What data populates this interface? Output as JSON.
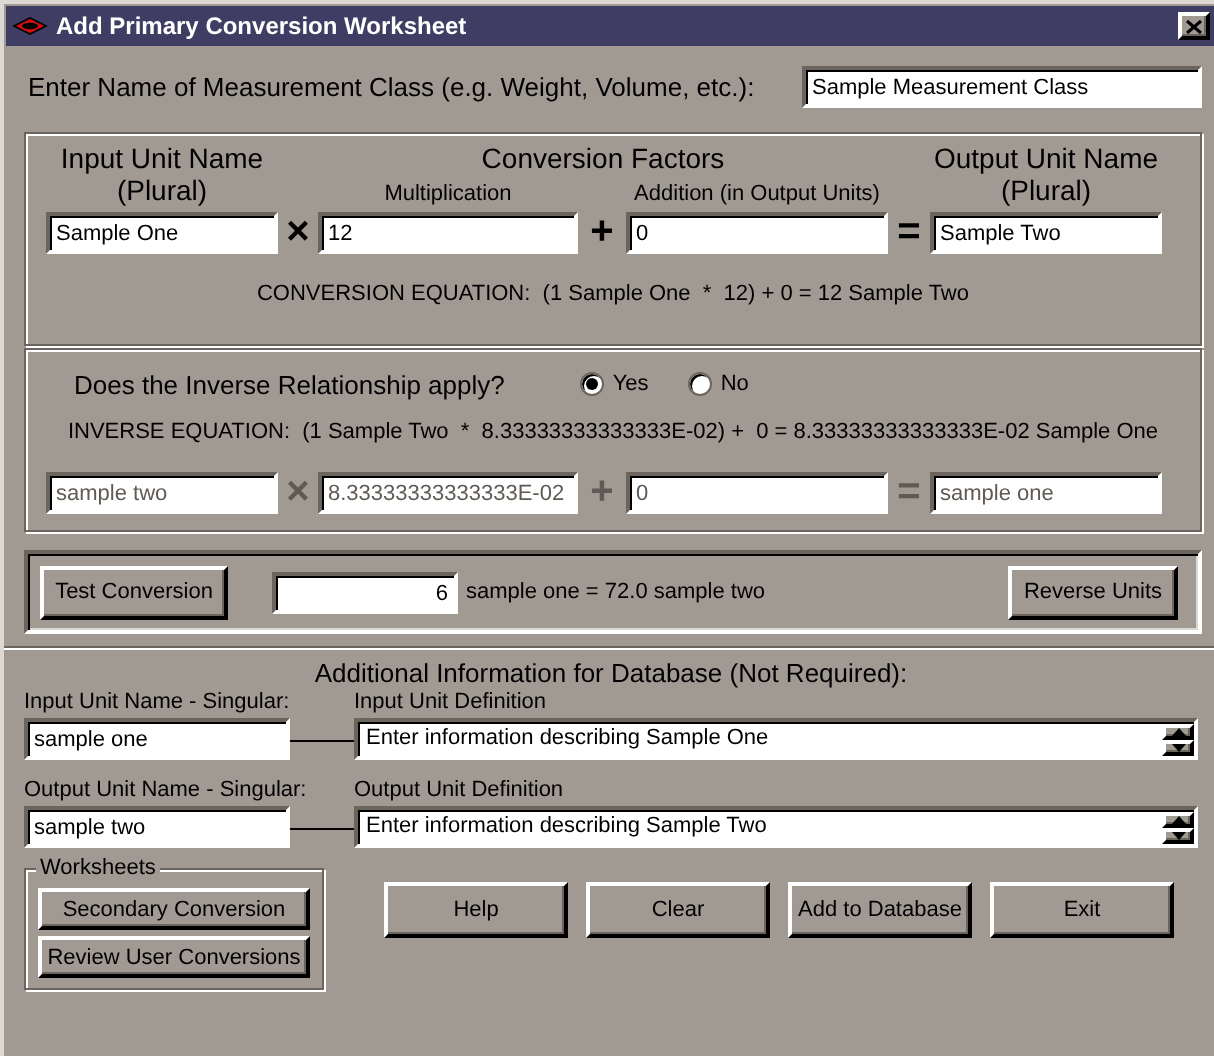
{
  "window": {
    "title": "Add Primary Conversion Worksheet"
  },
  "measurement_class": {
    "label": "Enter Name of Measurement Class (e.g. Weight, Volume, etc.):",
    "value": "Sample Measurement Class"
  },
  "conversion": {
    "input_heading": [
      "Input Unit Name",
      "(Plural)"
    ],
    "factors_heading": "Conversion Factors",
    "multiplication_label": "Multiplication",
    "addition_label": "Addition (in Output Units)",
    "output_heading": [
      "Output Unit Name",
      "(Plural)"
    ],
    "row": [
      {
        "kind": "field",
        "value": "Sample One",
        "disabled": false
      },
      {
        "kind": "operator",
        "text": "×",
        "disabled": false
      },
      {
        "kind": "field",
        "value": "12",
        "disabled": false
      },
      {
        "kind": "operator",
        "text": "+",
        "disabled": false
      },
      {
        "kind": "field",
        "value": "0",
        "disabled": false
      },
      {
        "kind": "operator",
        "text": "=",
        "disabled": false
      },
      {
        "kind": "field",
        "value": "Sample Two",
        "disabled": false
      }
    ],
    "equation": "CONVERSION EQUATION:  (1 Sample One  *  12) + 0 = 12 Sample Two"
  },
  "inverse": {
    "question": "Does the Inverse Relationship apply?",
    "options": [
      {
        "label": "Yes",
        "selected": true
      },
      {
        "label": "No",
        "selected": false
      }
    ],
    "equation": "INVERSE EQUATION:  (1 Sample Two  *  8.33333333333333E-02) +  0 = 8.33333333333333E-02 Sample One",
    "row": [
      {
        "kind": "field",
        "value": "sample two",
        "disabled": true
      },
      {
        "kind": "operator",
        "text": "×",
        "disabled": true
      },
      {
        "kind": "field",
        "value": "8.33333333333333E-02",
        "disabled": true
      },
      {
        "kind": "operator",
        "text": "+",
        "disabled": true
      },
      {
        "kind": "field",
        "value": "0",
        "disabled": true
      },
      {
        "kind": "operator",
        "text": "=",
        "disabled": true
      },
      {
        "kind": "field",
        "value": "sample one",
        "disabled": true
      }
    ]
  },
  "test": {
    "button": "Test Conversion",
    "value": "6",
    "result": "sample one = 72.0 sample two",
    "reverse_button": "Reverse Units"
  },
  "additional": {
    "heading": "Additional Information for Database (Not Required):",
    "units": [
      {
        "name_label": "Input Unit Name - Singular:",
        "name_value": "sample one",
        "definition_label": "Input Unit Definition",
        "definition_value": "Enter information describing Sample One"
      },
      {
        "name_label": "Output Unit Name - Singular:",
        "name_value": "sample two",
        "definition_label": "Output Unit Definition",
        "definition_value": "Enter information describing Sample Two"
      }
    ]
  },
  "worksheets": {
    "title": "Worksheets",
    "buttons": [
      "Secondary Conversion",
      "Review User Conversions"
    ]
  },
  "buttons": [
    "Help",
    "Clear",
    "Add to Database",
    "Exit"
  ]
}
